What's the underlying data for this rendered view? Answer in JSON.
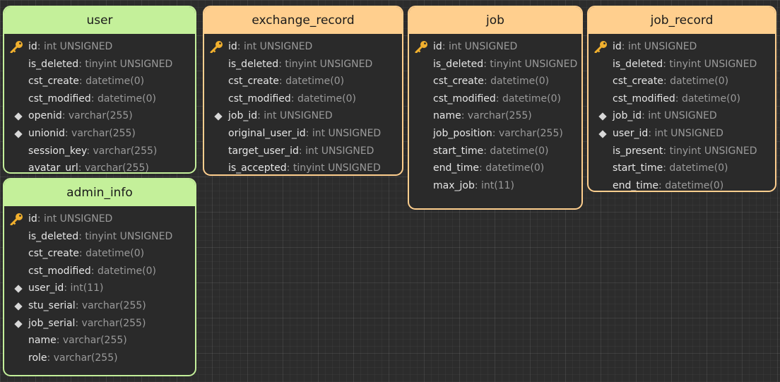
{
  "tables": [
    {
      "id": "user",
      "name": "user",
      "color": "green",
      "fields": [
        {
          "name": "id",
          "type": "int UNSIGNED",
          "marker": "key"
        },
        {
          "name": "is_deleted",
          "type": "tinyint UNSIGNED",
          "marker": ""
        },
        {
          "name": "cst_create",
          "type": "datetime(0)",
          "marker": ""
        },
        {
          "name": "cst_modified",
          "type": "datetime(0)",
          "marker": ""
        },
        {
          "name": "openid",
          "type": "varchar(255)",
          "marker": "index"
        },
        {
          "name": "unionid",
          "type": "varchar(255)",
          "marker": "index"
        },
        {
          "name": "session_key",
          "type": "varchar(255)",
          "marker": ""
        },
        {
          "name": "avatar_url",
          "type": "varchar(255)",
          "marker": ""
        }
      ]
    },
    {
      "id": "exchange_record",
      "name": "exchange_record",
      "color": "orange",
      "fields": [
        {
          "name": "id",
          "type": "int UNSIGNED",
          "marker": "key"
        },
        {
          "name": "is_deleted",
          "type": "tinyint UNSIGNED",
          "marker": ""
        },
        {
          "name": "cst_create",
          "type": "datetime(0)",
          "marker": ""
        },
        {
          "name": "cst_modified",
          "type": "datetime(0)",
          "marker": ""
        },
        {
          "name": "job_id",
          "type": "int UNSIGNED",
          "marker": "index"
        },
        {
          "name": "original_user_id",
          "type": "int UNSIGNED",
          "marker": ""
        },
        {
          "name": "target_user_id",
          "type": "int UNSIGNED",
          "marker": ""
        },
        {
          "name": "is_accepted",
          "type": "tinyint UNSIGNED",
          "marker": ""
        }
      ]
    },
    {
      "id": "job",
      "name": "job",
      "color": "orange",
      "fields": [
        {
          "name": "id",
          "type": "int UNSIGNED",
          "marker": "key"
        },
        {
          "name": "is_deleted",
          "type": "tinyint UNSIGNED",
          "marker": ""
        },
        {
          "name": "cst_create",
          "type": "datetime(0)",
          "marker": ""
        },
        {
          "name": "cst_modified",
          "type": "datetime(0)",
          "marker": ""
        },
        {
          "name": "name",
          "type": "varchar(255)",
          "marker": ""
        },
        {
          "name": "job_position",
          "type": "varchar(255)",
          "marker": ""
        },
        {
          "name": "start_time",
          "type": "datetime(0)",
          "marker": ""
        },
        {
          "name": "end_time",
          "type": "datetime(0)",
          "marker": ""
        },
        {
          "name": "max_job",
          "type": "int(11)",
          "marker": ""
        }
      ]
    },
    {
      "id": "job_record",
      "name": "job_record",
      "color": "orange",
      "fields": [
        {
          "name": "id",
          "type": "int UNSIGNED",
          "marker": "key"
        },
        {
          "name": "is_deleted",
          "type": "tinyint UNSIGNED",
          "marker": ""
        },
        {
          "name": "cst_create",
          "type": "datetime(0)",
          "marker": ""
        },
        {
          "name": "cst_modified",
          "type": "datetime(0)",
          "marker": ""
        },
        {
          "name": "job_id",
          "type": "int UNSIGNED",
          "marker": "index"
        },
        {
          "name": "user_id",
          "type": "int UNSIGNED",
          "marker": "index"
        },
        {
          "name": "is_present",
          "type": "tinyint UNSIGNED",
          "marker": ""
        },
        {
          "name": "start_time",
          "type": "datetime(0)",
          "marker": ""
        },
        {
          "name": "end_time",
          "type": "datetime(0)",
          "marker": ""
        }
      ]
    },
    {
      "id": "admin_info",
      "name": "admin_info",
      "color": "green",
      "fields": [
        {
          "name": "id",
          "type": "int UNSIGNED",
          "marker": "key"
        },
        {
          "name": "is_deleted",
          "type": "tinyint UNSIGNED",
          "marker": ""
        },
        {
          "name": "cst_create",
          "type": "datetime(0)",
          "marker": ""
        },
        {
          "name": "cst_modified",
          "type": "datetime(0)",
          "marker": ""
        },
        {
          "name": "user_id",
          "type": "int(11)",
          "marker": "index"
        },
        {
          "name": "stu_serial",
          "type": "varchar(255)",
          "marker": "index"
        },
        {
          "name": "job_serial",
          "type": "varchar(255)",
          "marker": "index"
        },
        {
          "name": "name",
          "type": "varchar(255)",
          "marker": ""
        },
        {
          "name": "role",
          "type": "varchar(255)",
          "marker": ""
        }
      ]
    }
  ],
  "colors": {
    "green_header": "#c4f09a",
    "orange_header": "#ffcf8e",
    "key_icon": "#f1b02e"
  }
}
